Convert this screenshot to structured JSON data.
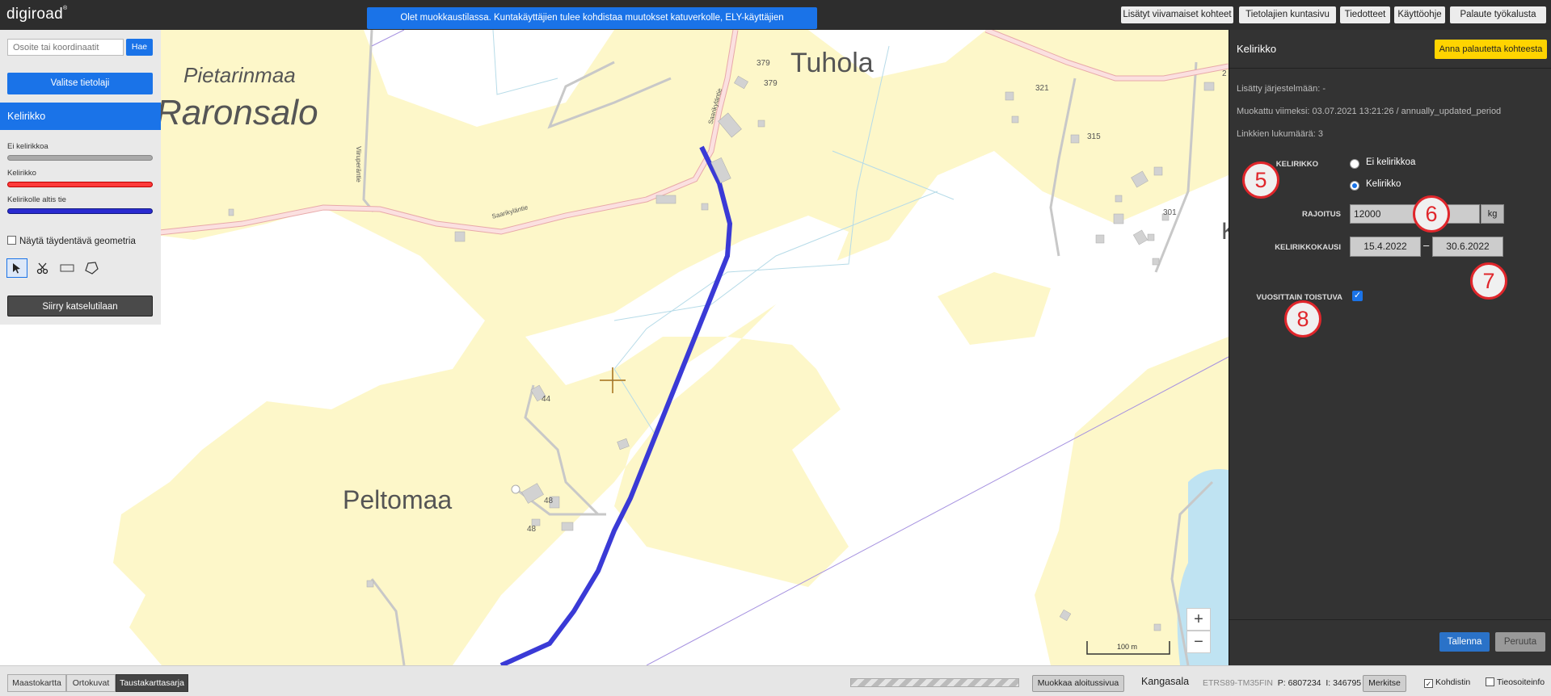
{
  "topbar": {
    "logo": "digiroad",
    "logo_mark": "®",
    "edit_notice": "Olet muokkaustilassa. Kuntakäyttäjien tulee kohdistaa muutokset katuverkolle, ELY-käyttäjien maantieverkolle.",
    "buttons": [
      "Lisätyt viivamaiset kohteet",
      "Tietolajien kuntasivu",
      "Tiedotteet",
      "Käyttöohje",
      "Palaute työkalusta"
    ]
  },
  "left_panel": {
    "search_placeholder": "Osoite tai koordinaatit",
    "search_button": "Hae",
    "select_layer_button": "Valitse tietolaji",
    "layer_title": "Kelirikko",
    "legend": [
      {
        "label": "Ei kelirikkoa",
        "color": "#a9a9a9"
      },
      {
        "label": "Kelirikko",
        "color": "#ff3b3b"
      },
      {
        "label": "Kelirikolle altis tie",
        "color": "#2b2bd1"
      }
    ],
    "geometry_checkbox": "Näytä täydentävä geometria",
    "tools": [
      "select-tool-icon",
      "cut-tool-icon",
      "rectangle-tool-icon",
      "polygon-tool-icon"
    ],
    "view_mode_button": "Siirry katselutilaan"
  },
  "map": {
    "place_names": [
      "Pietarinmaa",
      "Raronsalo",
      "Tuhola",
      "Peltomaa"
    ],
    "road_names": [
      "Saarikyläntie",
      "Saarikyläntie",
      "Viiruperäntie"
    ],
    "house_numbers": [
      "379",
      "379",
      "321",
      "315",
      "301",
      "44",
      "48",
      "48",
      "2"
    ],
    "edge_letter": "K",
    "scale_label": "100 m",
    "zoom_in": "+",
    "zoom_out": "−"
  },
  "right_panel": {
    "title": "Kelirikko",
    "feedback_button": "Anna palautetta kohteesta",
    "added_info": "Lisätty järjestelmään: -",
    "modified_info": "Muokattu viimeksi: 03.07.2021 13:21:26 / annually_updated_period",
    "link_count": "Linkkien lukumäärä: 3",
    "kelirikko_label": "KELIRIKKO",
    "radio_options": [
      "Ei kelirikkoa",
      "Kelirikko"
    ],
    "selected_option": "Kelirikko",
    "limit_label": "RAJOITUS",
    "limit_value": "12000",
    "limit_unit": "kg",
    "period_label": "KELIRIKKOKAUSI",
    "period_start": "15.4.2022",
    "period_separator": "–",
    "period_end": "30.6.2022",
    "repeat_label": "VUOSITTAIN TOISTUVA",
    "repeat_checked": true,
    "step_markers": [
      "5",
      "6",
      "7",
      "8"
    ],
    "save_button": "Tallenna",
    "cancel_button": "Peruuta"
  },
  "bottombar": {
    "base_maps": [
      "Maastokartta",
      "Ortokuvat",
      "Taustakarttasarja"
    ],
    "active_base_map": "Taustakarttasarja",
    "start_page_button": "Muokkaa aloitussivua",
    "municipality": "Kangasala",
    "crs": "ETRS89-TM35FIN",
    "coord_p": "P: 6807234",
    "coord_i": "I: 346795",
    "mark_button": "Merkitse",
    "cursor_check": "Kohdistin",
    "cursor_checked": true,
    "roadinfo_check": "Tieosoiteinfo",
    "roadinfo_checked": false
  },
  "colors": {
    "accent": "#1a73e8",
    "selected_road": "#3a3ad6",
    "map_yellow": "#fdf7c9",
    "marker_red": "#e0262b",
    "feedback_yellow": "#ffd400"
  }
}
